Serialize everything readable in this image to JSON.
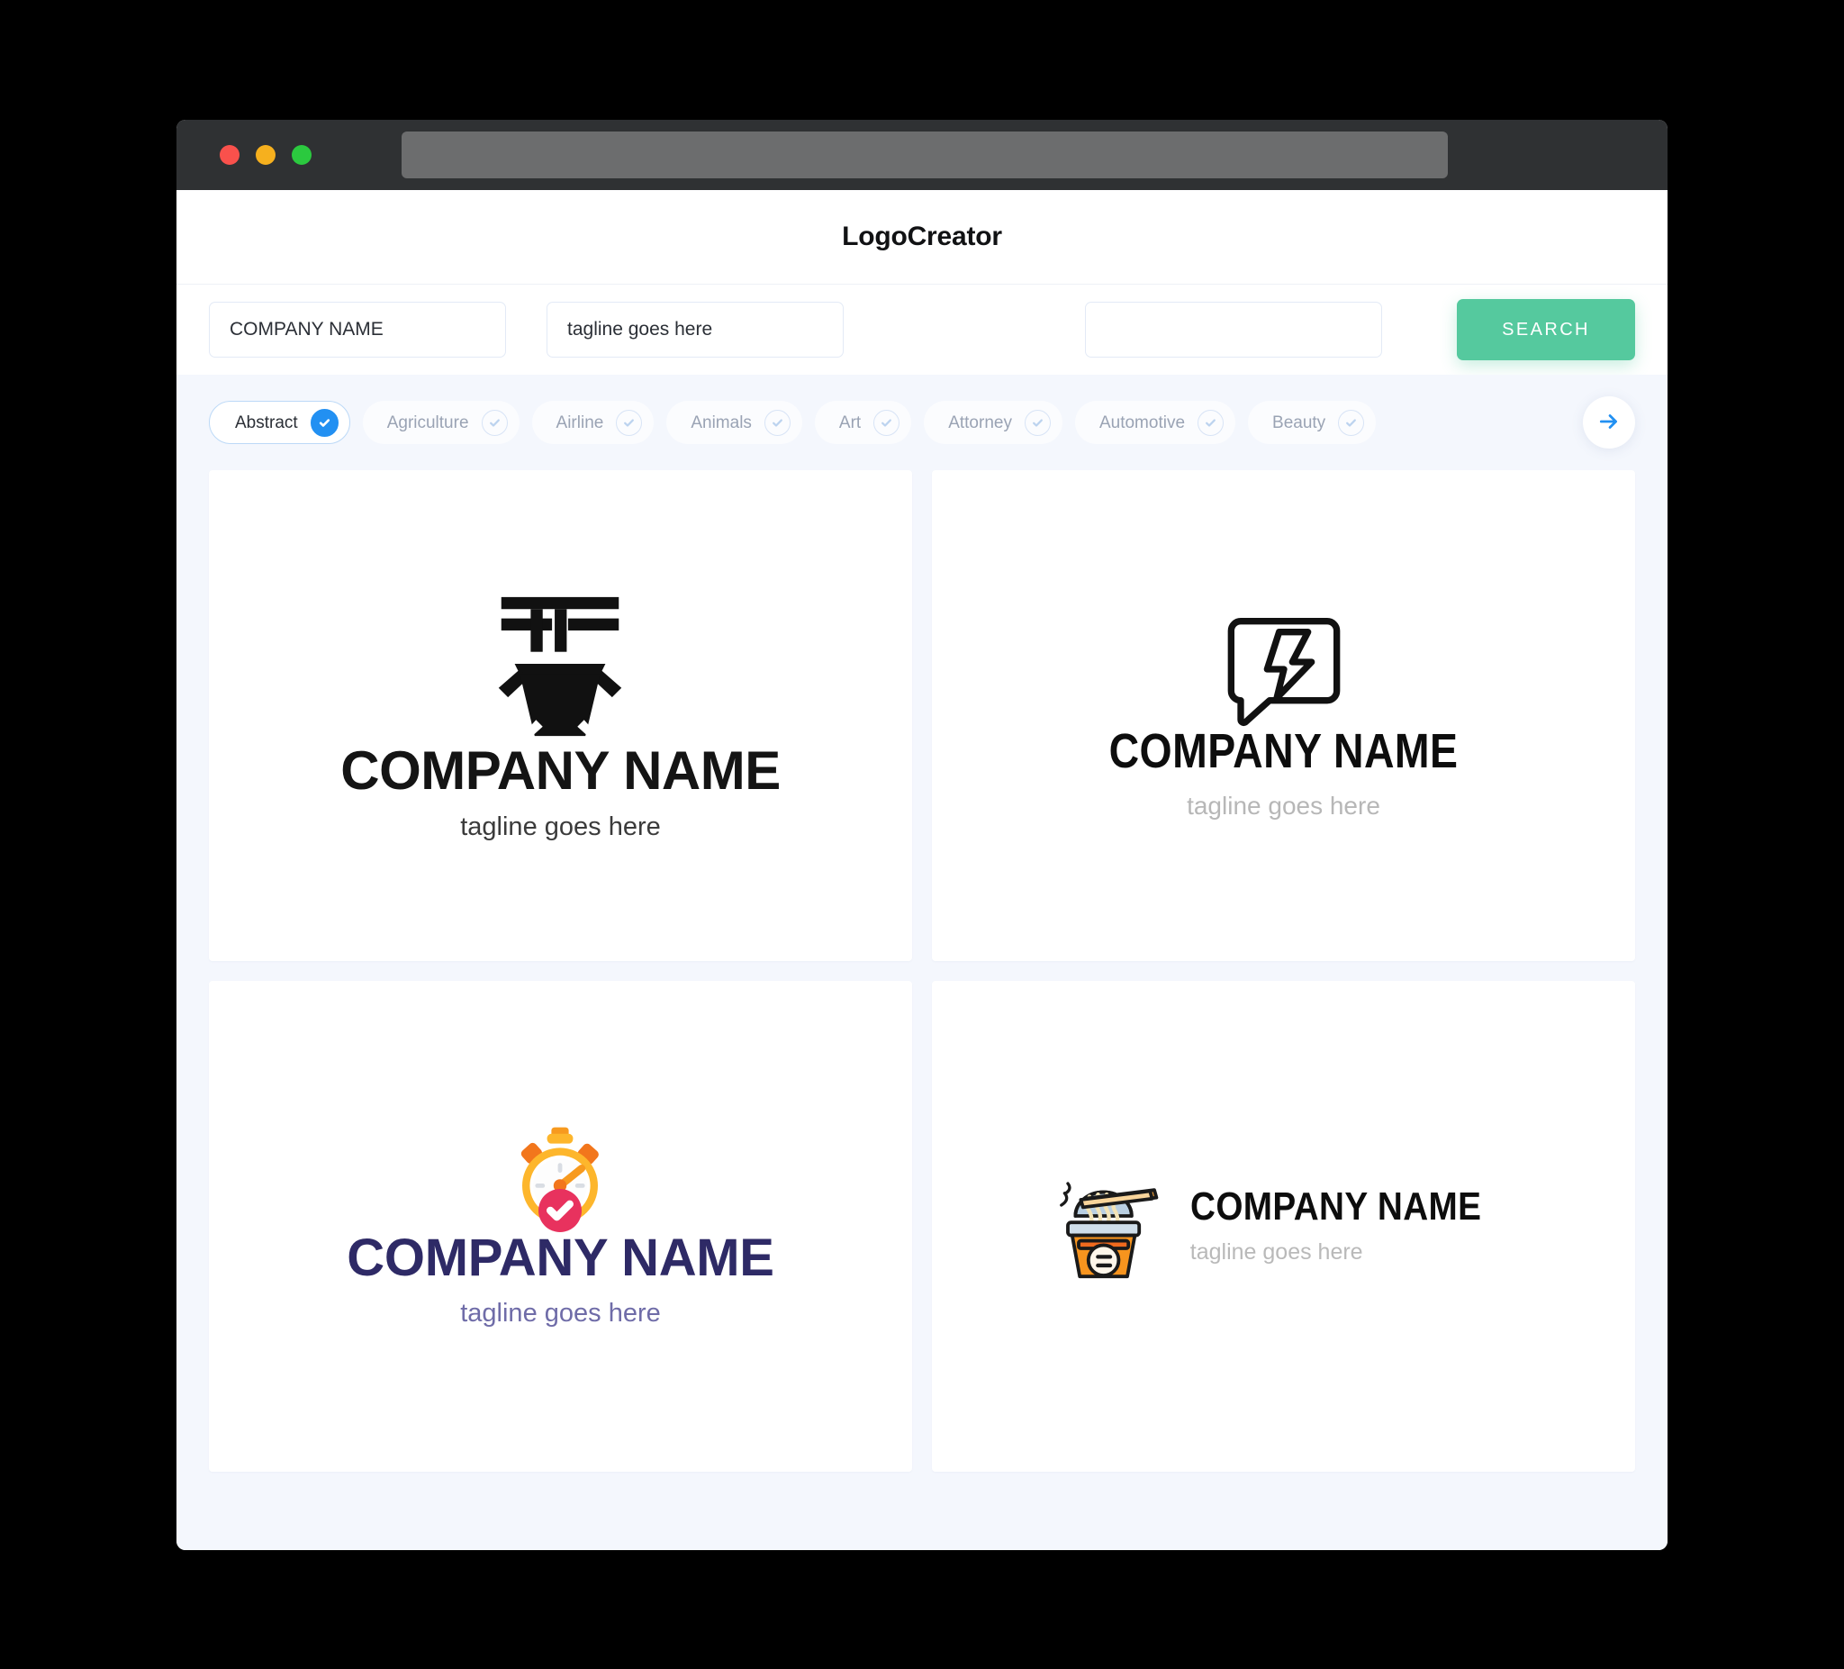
{
  "window": {
    "traffic_lights": [
      "close",
      "minimize",
      "maximize"
    ],
    "url_value": ""
  },
  "header": {
    "title": "LogoCreator"
  },
  "search": {
    "company_value": "COMPANY NAME",
    "company_placeholder": "COMPANY NAME",
    "tagline_value": "tagline goes here",
    "tagline_placeholder": "tagline goes here",
    "extra_value": "",
    "extra_placeholder": "",
    "search_label": "SEARCH",
    "search_color": "#55c99e"
  },
  "filters": {
    "next_icon": "arrow-right-icon",
    "accent_color": "#2290f2",
    "chips": [
      {
        "label": "Abstract",
        "selected": true
      },
      {
        "label": "Agriculture",
        "selected": false
      },
      {
        "label": "Airline",
        "selected": false
      },
      {
        "label": "Animals",
        "selected": false
      },
      {
        "label": "Art",
        "selected": false
      },
      {
        "label": "Attorney",
        "selected": false
      },
      {
        "label": "Automotive",
        "selected": false
      },
      {
        "label": "Beauty",
        "selected": false
      }
    ]
  },
  "results": {
    "cards": [
      {
        "icon": "abstract-pillar-cup-mark-icon",
        "name": "COMPANY NAME",
        "tagline": "tagline goes here",
        "name_color": "#141414",
        "tagline_color": "#3b3b3b",
        "layout": "stacked"
      },
      {
        "icon": "speech-bubble-lightning-bolt-icon",
        "name": "COMPANY NAME",
        "tagline": "tagline goes here",
        "name_color": "#0d0d0d",
        "tagline_color": "#b7b7b7",
        "layout": "stacked"
      },
      {
        "icon": "stopwatch-check-icon",
        "name": "COMPANY NAME",
        "tagline": "tagline goes here",
        "name_color": "#2e2a66",
        "tagline_color": "#6f6ca8",
        "layout": "stacked"
      },
      {
        "icon": "noodle-cup-chopsticks-icon",
        "name": "COMPANY NAME",
        "tagline": "tagline goes here",
        "name_color": "#0d0d0d",
        "tagline_color": "#b9b9b9",
        "layout": "horizontal"
      }
    ]
  }
}
